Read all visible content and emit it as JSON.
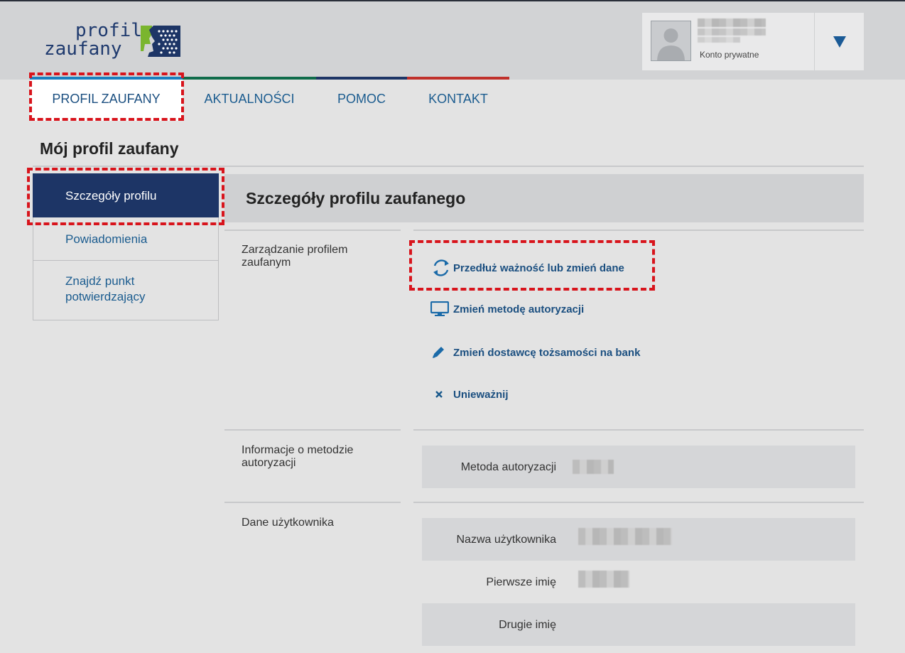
{
  "logo": {
    "line1": "profil",
    "line2": "zaufany"
  },
  "account": {
    "type": "Konto prywatne"
  },
  "nav": {
    "items": [
      {
        "label": "PROFIL ZAUFANY"
      },
      {
        "label": "AKTUALNOŚCI"
      },
      {
        "label": "POMOC"
      },
      {
        "label": "KONTAKT"
      }
    ],
    "colors": [
      "#1a7fbf",
      "#0f6b4a",
      "#1d3566",
      "#c0302b"
    ]
  },
  "page": {
    "title": "Mój profil zaufany"
  },
  "sidebar": {
    "items": [
      {
        "label": "Szczegóły profilu"
      },
      {
        "label": "Powiadomienia"
      },
      {
        "label": "Znajdź punkt potwierdzający"
      }
    ]
  },
  "content": {
    "title": "Szczegóły profilu zaufanego",
    "manage": {
      "label": "Zarządzanie profilem zaufanym",
      "links": [
        {
          "label": "Przedłuż ważność lub zmień dane",
          "icon": "refresh-icon"
        },
        {
          "label": "Zmień metodę autoryzacji",
          "icon": "monitor-icon"
        },
        {
          "label": "Zmień dostawcę tożsamości na bank",
          "icon": "pencil-icon"
        },
        {
          "label": "Unieważnij",
          "icon": "close-icon"
        }
      ]
    },
    "auth": {
      "label": "Informacje o metodzie autoryzacji",
      "fields": [
        {
          "label": "Metoda autoryzacji"
        }
      ]
    },
    "user": {
      "label": "Dane użytkownika",
      "fields": [
        {
          "label": "Nazwa użytkownika"
        },
        {
          "label": "Pierwsze imię"
        },
        {
          "label": "Drugie imię"
        }
      ]
    }
  },
  "colors": {
    "accent": "#1b4f80",
    "sidebar_active": "#1d3566",
    "highlight": "#d8141c"
  }
}
